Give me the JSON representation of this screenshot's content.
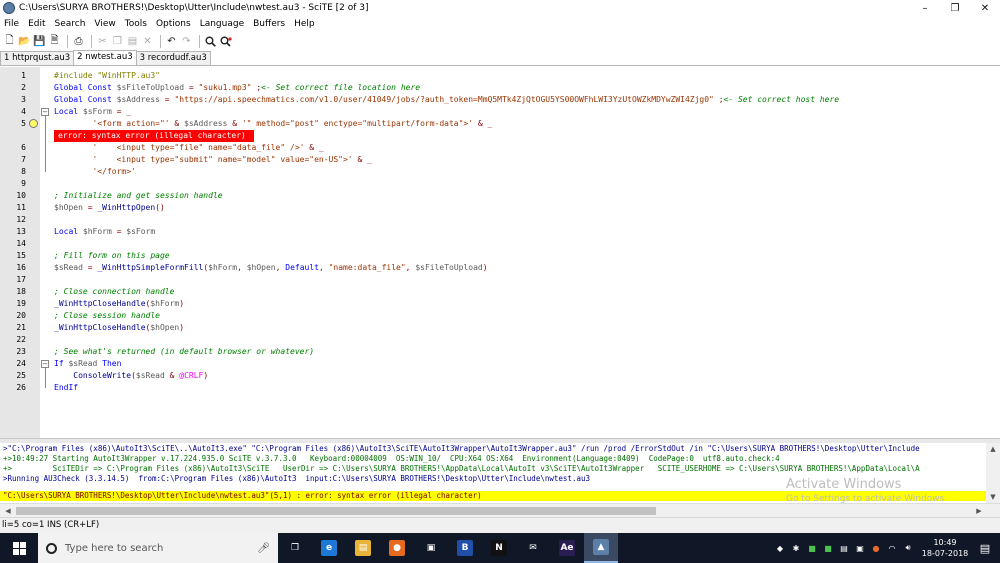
{
  "window": {
    "title": "C:\\Users\\SURYA BROTHERS!\\Desktop\\Utter\\Include\\nwtest.au3 - SciTE [2 of 3]",
    "minimize": "–",
    "maximize": "❐",
    "close": "✕"
  },
  "menu": [
    "File",
    "Edit",
    "Search",
    "View",
    "Tools",
    "Options",
    "Language",
    "Buffers",
    "Help"
  ],
  "toolbar": {
    "icons": [
      "new-file-icon",
      "open-folder-icon",
      "save-icon",
      "save-as-icon",
      "print-icon",
      "cut-icon",
      "copy-icon",
      "paste-icon",
      "delete-icon",
      "undo-icon",
      "redo-icon",
      "find-icon",
      "replace-icon"
    ]
  },
  "tabs": [
    {
      "label": "1 httprqust.au3",
      "active": false
    },
    {
      "label": "2 nwtest.au3",
      "active": true
    },
    {
      "label": "3 recordudf.au3",
      "active": false
    }
  ],
  "editor": {
    "error_line_index": 4,
    "error_annotation": "  error: syntax error (illegal character)",
    "lines": [
      {
        "num": "1",
        "segs": [
          [
            "pre",
            "#include \"WinHTTP.au3\""
          ]
        ]
      },
      {
        "num": "2",
        "segs": [
          [
            "kw",
            "Global Const "
          ],
          [
            "var",
            "$sFileToUpload"
          ],
          [
            "op",
            " = "
          ],
          [
            "str",
            "\"suku1.mp3\""
          ],
          [
            "op",
            " ;"
          ],
          [
            "cmt",
            "<- Set correct file location here"
          ]
        ]
      },
      {
        "num": "3",
        "segs": [
          [
            "kw",
            "Global Const "
          ],
          [
            "var",
            "$sAddress"
          ],
          [
            "op",
            " = "
          ],
          [
            "str",
            "\"https://api.speechmatics.com/v1.0/user/41049/jobs/?auth_token=MmQ5MTk4ZjQtOGU5YS00OWFhLWI3YzUtOWZkMDYwZWI4Zjg0\""
          ],
          [
            "op",
            " ;"
          ],
          [
            "cmt",
            "<- Set correct host here"
          ]
        ]
      },
      {
        "num": "4",
        "segs": [
          [
            "kw",
            "Local "
          ],
          [
            "var",
            "$sForm"
          ],
          [
            "op",
            " = _"
          ]
        ]
      },
      {
        "num": "5",
        "segs": [
          [
            "op",
            "        "
          ],
          [
            "str",
            "'<form action=\"'"
          ],
          [
            "op",
            " & "
          ],
          [
            "var",
            "$sAddress"
          ],
          [
            "op",
            " & "
          ],
          [
            "str",
            "'\" method=\"post\" enctype=\"multipart/form-data\">'"
          ],
          [
            "op",
            " & _"
          ]
        ]
      },
      {
        "num": "6",
        "segs": [
          [
            "op",
            "        "
          ],
          [
            "str",
            "'    <input type=\"file\" name=\"data_file\" />'"
          ],
          [
            "op",
            " & _"
          ]
        ]
      },
      {
        "num": "7",
        "segs": [
          [
            "op",
            "        "
          ],
          [
            "str",
            "'    <input type=\"submit\" name=\"model\" value=\"en-US\">'"
          ],
          [
            "op",
            " & _"
          ]
        ]
      },
      {
        "num": "8",
        "segs": [
          [
            "op",
            "        "
          ],
          [
            "str",
            "'</form>'"
          ]
        ]
      },
      {
        "num": "9",
        "segs": []
      },
      {
        "num": "10",
        "segs": [
          [
            "cmt",
            "; Initialize and get session handle"
          ]
        ]
      },
      {
        "num": "11",
        "segs": [
          [
            "var",
            "$hOpen"
          ],
          [
            "op",
            " = "
          ],
          [
            "fn",
            "_WinHttpOpen"
          ],
          [
            "op",
            "()"
          ]
        ]
      },
      {
        "num": "12",
        "segs": []
      },
      {
        "num": "13",
        "segs": [
          [
            "kw",
            "Local "
          ],
          [
            "var",
            "$hForm"
          ],
          [
            "op",
            " = "
          ],
          [
            "var",
            "$sForm"
          ]
        ]
      },
      {
        "num": "14",
        "segs": []
      },
      {
        "num": "15",
        "segs": [
          [
            "cmt",
            "; Fill form on this page"
          ]
        ]
      },
      {
        "num": "16",
        "segs": [
          [
            "var",
            "$sRead"
          ],
          [
            "op",
            " = "
          ],
          [
            "fn",
            "_WinHttpSimpleFormFill"
          ],
          [
            "op",
            "("
          ],
          [
            "var",
            "$hForm"
          ],
          [
            "op",
            ", "
          ],
          [
            "var",
            "$hOpen"
          ],
          [
            "op",
            ", "
          ],
          [
            "kw",
            "Default"
          ],
          [
            "op",
            ", "
          ],
          [
            "str",
            "\"name:data_file\""
          ],
          [
            "op",
            ", "
          ],
          [
            "var",
            "$sFileToUpload"
          ],
          [
            "op",
            ")"
          ]
        ]
      },
      {
        "num": "17",
        "segs": []
      },
      {
        "num": "18",
        "segs": [
          [
            "cmt",
            "; Close connection handle"
          ]
        ]
      },
      {
        "num": "19",
        "segs": [
          [
            "fn",
            "_WinHttpCloseHandle"
          ],
          [
            "op",
            "("
          ],
          [
            "var",
            "$hForm"
          ],
          [
            "op",
            ")"
          ]
        ]
      },
      {
        "num": "20",
        "segs": [
          [
            "cmt",
            "; Close session handle"
          ]
        ]
      },
      {
        "num": "21",
        "segs": [
          [
            "fn",
            "_WinHttpCloseHandle"
          ],
          [
            "op",
            "("
          ],
          [
            "var",
            "$hOpen"
          ],
          [
            "op",
            ")"
          ]
        ]
      },
      {
        "num": "22",
        "segs": []
      },
      {
        "num": "23",
        "segs": [
          [
            "cmt",
            "; See what's returned (in default browser or whatever)"
          ]
        ]
      },
      {
        "num": "24",
        "segs": [
          [
            "kw",
            "If "
          ],
          [
            "var",
            "$sRead"
          ],
          [
            "kw",
            " Then"
          ]
        ]
      },
      {
        "num": "25",
        "segs": [
          [
            "op",
            "    "
          ],
          [
            "fn",
            "ConsoleWrite"
          ],
          [
            "op",
            "("
          ],
          [
            "var",
            "$sRead"
          ],
          [
            "op",
            " & "
          ],
          [
            "mac",
            "@CRLF"
          ],
          [
            "op",
            ")"
          ]
        ]
      },
      {
        "num": "26",
        "segs": [
          [
            "kw",
            "EndIf"
          ]
        ]
      }
    ]
  },
  "output": {
    "lines": [
      {
        "cls": "out-cmd",
        "text": ">\"C:\\Program Files (x86)\\AutoIt3\\SciTE\\..\\AutoIt3.exe\" \"C:\\Program Files (x86)\\AutoIt3\\SciTE\\AutoIt3Wrapper\\AutoIt3Wrapper.au3\" /run /prod /ErrorStdOut /in \"C:\\Users\\SURYA BROTHERS!\\Desktop\\Utter\\Include"
      },
      {
        "cls": "out-info",
        "text": "+>10:49:27 Starting AutoIt3Wrapper v.17.224.935.0 SciTE v.3.7.3.0   Keyboard:00004009  OS:WIN_10/  CPU:X64 OS:X64  Environment(Language:0409)  CodePage:0  utf8.auto.check:4"
      },
      {
        "cls": "out-info",
        "text": "+>         SciTEDir => C:\\Program Files (x86)\\AutoIt3\\SciTE   UserDir => C:\\Users\\SURYA BROTHERS!\\AppData\\Local\\AutoIt v3\\SciTE\\AutoIt3Wrapper   SCITE_USERHOME => C:\\Users\\SURYA BROTHERS!\\AppData\\Local\\A"
      },
      {
        "cls": "out-run",
        "text": ">Running AU3Check (3.3.14.5)  from:C:\\Program Files (x86)\\AutoIt3  input:C:\\Users\\SURYA BROTHERS!\\Desktop\\Utter\\Include\\nwtest.au3"
      },
      {
        "cls": "err",
        "text": "\"C:\\Users\\SURYA BROTHERS!\\Desktop\\Utter\\Include\\nwtest.au3\"(5,1) : error: syntax error (illegal character)"
      }
    ]
  },
  "watermark": {
    "title": "Activate Windows",
    "subtitle": "Go to Settings to activate Windows."
  },
  "status": "li=5 co=1 INS (CR+LF)",
  "taskbar": {
    "search_placeholder": "Type here to search",
    "apps": [
      {
        "name": "task-view-icon",
        "glyph": "❐",
        "bg": "transparent",
        "active": false
      },
      {
        "name": "edge-icon",
        "glyph": "e",
        "bg": "#1e78d6",
        "active": false
      },
      {
        "name": "file-explorer-icon",
        "glyph": "▤",
        "bg": "#e8b43a",
        "active": false
      },
      {
        "name": "firefox-icon",
        "glyph": "●",
        "bg": "#e66a1f",
        "active": false
      },
      {
        "name": "store-icon",
        "glyph": "▣",
        "bg": "transparent",
        "active": false
      },
      {
        "name": "b-app-icon",
        "glyph": "B",
        "bg": "#1f4fa8",
        "active": false
      },
      {
        "name": "netflix-icon",
        "glyph": "N",
        "bg": "#111111",
        "active": false
      },
      {
        "name": "mail-icon",
        "glyph": "✉",
        "bg": "transparent",
        "active": false
      },
      {
        "name": "after-effects-icon",
        "glyph": "Ae",
        "bg": "#2a1d52",
        "active": false
      },
      {
        "name": "scite-taskbar-icon",
        "glyph": "▲",
        "bg": "#5b7fa6",
        "active": true
      }
    ],
    "tray_icons": [
      "network-tray-icon",
      "bluetooth-tray-icon",
      "shield-tray-icon",
      "app-tray-icon",
      "keyboard-tray-icon",
      "app2-tray-icon",
      "ime-tray-icon",
      "wifi-tray-icon",
      "volume-tray-icon"
    ],
    "time": "10:49",
    "date": "18-07-2018"
  },
  "colors": {
    "error_bg": "#ff0000",
    "output_error_bg": "#ffff00",
    "taskbar_bg": "#101828"
  }
}
